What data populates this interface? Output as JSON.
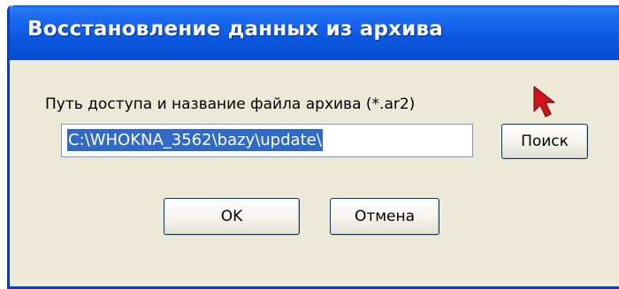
{
  "window": {
    "title": "Восстановление данных из архива"
  },
  "form": {
    "path_label": "Путь доступа и название файла архива (*.ar2)",
    "path_value": "C:\\WHOKNA_3562\\bazy\\update\\",
    "search_label": "Поиск",
    "ok_label": "OK",
    "cancel_label": "Отмена"
  },
  "colors": {
    "titlebar": "#0a58e0",
    "dialog_bg": "#ece9d8",
    "selection": "#316ac5",
    "cursor": "#d0141a"
  },
  "icons": {
    "pointer": "red-arrow-cursor-icon"
  }
}
